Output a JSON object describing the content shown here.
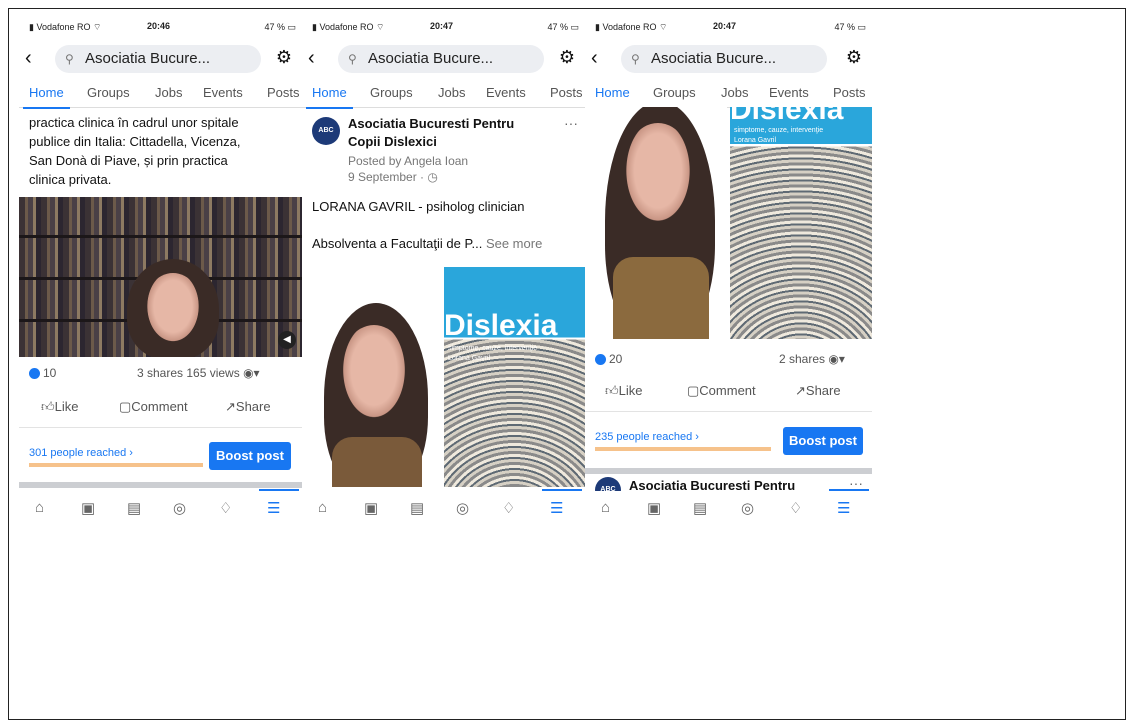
{
  "phones": [
    {
      "status": {
        "carrier": "Vodafone RO",
        "time": "20:46",
        "battery": "47 %"
      },
      "search": {
        "text": "Asociatia Bucure..."
      },
      "tabs": [
        "Home",
        "Groups",
        "Jobs",
        "Events",
        "Posts"
      ],
      "body_lines": [
        "practica clinica în cadrul unor spitale",
        "publice din Italia: Cittadella, Vicenza,",
        "San Donà di Piave, și prin practica",
        "clinica privata."
      ],
      "stats": {
        "likes": "10",
        "shares_views": "3 shares  165 views"
      },
      "actions": {
        "like": "Like",
        "comment": "Comment",
        "share": "Share"
      },
      "reached": "301 people reached ›",
      "boost": "Boost post"
    },
    {
      "status": {
        "carrier": "Vodafone RO",
        "time": "20:47",
        "battery": "47 %"
      },
      "search": {
        "text": "Asociatia Bucure..."
      },
      "tabs": [
        "Home",
        "Groups",
        "Jobs",
        "Events",
        "Posts"
      ],
      "post": {
        "page_name_1": "Asociatia Bucuresti Pentru",
        "page_name_2": "Copii Dislexici",
        "posted_by": "Posted by Angela Ioan",
        "date": "9 September · ◷",
        "line1": "LORANA GAVRIL - psiholog clinician",
        "line2": "Absolventa a Facultaţii de P...",
        "see_more": "See more",
        "more": "···"
      },
      "cover": {
        "title": "Dislexia",
        "subtitle": "simptome, cauze, intervenţie",
        "author": "Lorana Gavril"
      }
    },
    {
      "status": {
        "carrier": "Vodafone RO",
        "time": "20:47",
        "battery": "47 %"
      },
      "search": {
        "text": "Asociatia Bucure..."
      },
      "tabs": [
        "Home",
        "Groups",
        "Jobs",
        "Events",
        "Posts"
      ],
      "cover": {
        "title": "Dislexia",
        "subtitle": "simptome, cauze, intervenţie",
        "author": "Lorana Gavril"
      },
      "stats": {
        "likes": "20",
        "shares": "2 shares"
      },
      "actions": {
        "like": "Like",
        "comment": "Comment",
        "share": "Share"
      },
      "reached": "235 people reached ›",
      "boost": "Boost post",
      "next_post": "Asociatia Bucuresti Pentru",
      "more": "···"
    }
  ],
  "colors": {
    "accent": "#1877f2",
    "reach_bar": "#f6c28b"
  },
  "icons": [
    "home-icon",
    "watch-icon",
    "marketplace-icon",
    "groups-icon",
    "bell-icon",
    "menu-icon"
  ]
}
